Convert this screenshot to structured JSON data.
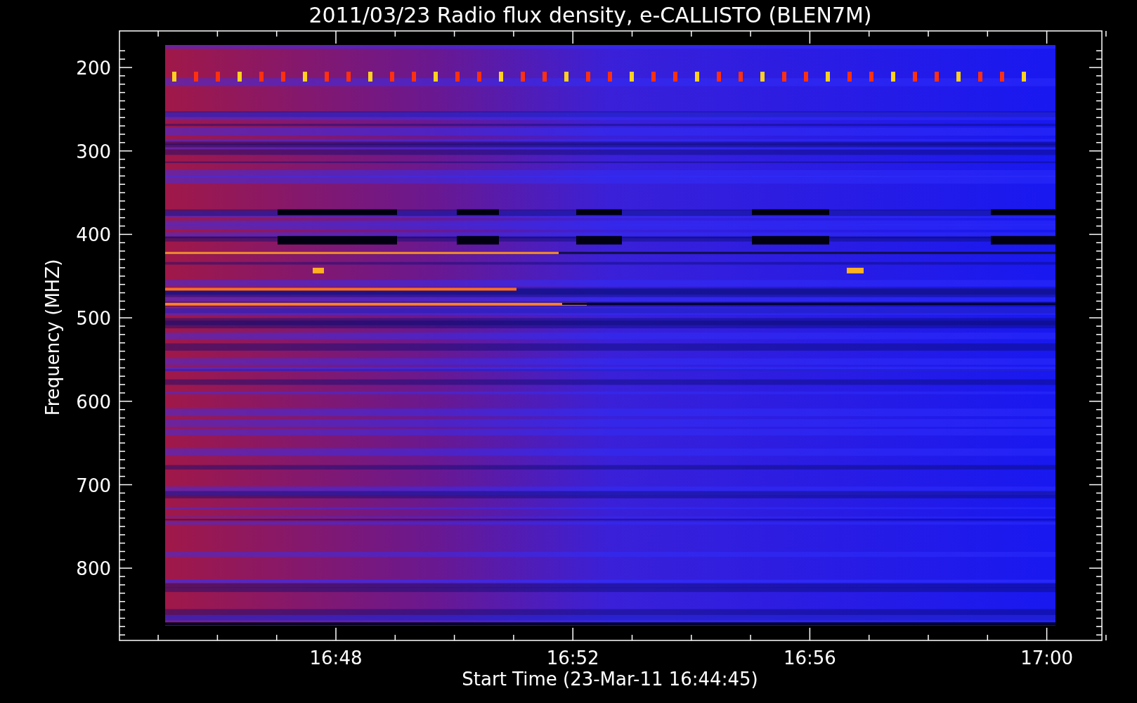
{
  "title": "2011/03/23  Radio flux density, e-CALLISTO (BLEN7M)",
  "y_axis": {
    "label": "Frequency (MHZ)",
    "ticks": [
      "200",
      "300",
      "400",
      "500",
      "600",
      "700",
      "800"
    ]
  },
  "x_axis": {
    "label": "Start Time (23-Mar-11 16:44:45)",
    "ticks": [
      "16:48",
      "16:52",
      "16:56",
      "17:00"
    ]
  }
}
